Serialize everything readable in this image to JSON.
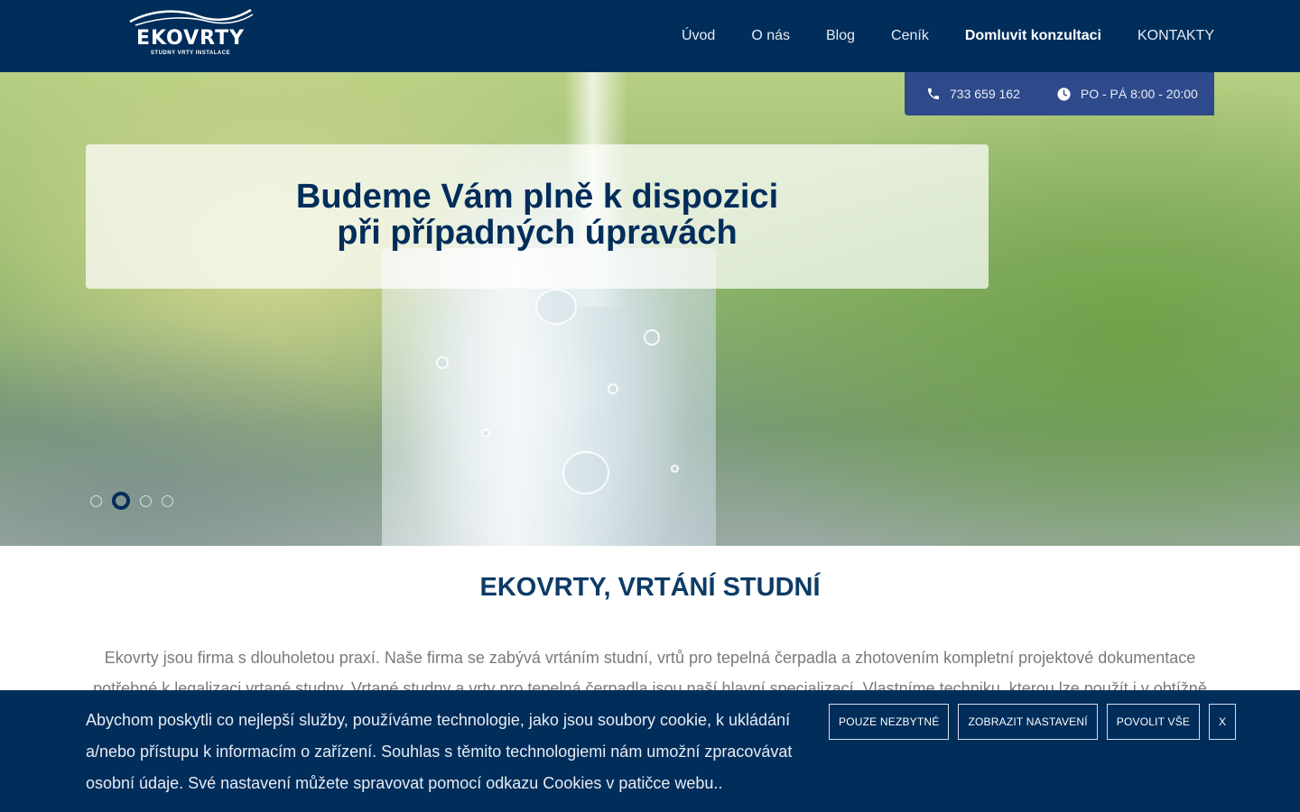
{
  "header": {
    "logo_text": "EKOVRTY",
    "logo_tagline": "STUDNY VRTY INSTALACE",
    "nav": [
      "Úvod",
      "O nás",
      "Blog",
      "Ceník",
      "Domluvit konzultaci",
      "KONTAKTY"
    ]
  },
  "contact": {
    "phone": "733 659 162",
    "hours": "PO - PÁ 8:00 - 20:00"
  },
  "hero": {
    "line1": "Budeme Vám plně k dispozici",
    "line2": "při případných úpravách",
    "slides_count": 4,
    "active_slide": 2
  },
  "main": {
    "title": "EKOVRTY, VRTÁNÍ STUDNÍ",
    "intro": "Ekovrty jsou firma s dlouholetou praxí. Naše firma se zabývá vrtáním studní, vrtů pro tepelná čerpadla a zhotovením kompletní projektové dokumentace potřebné k legalizaci vrtané studny. Vrtané studny a vrty pro tepelná čerpadla jsou naší hlavní specializací. Vlastníme techniku, kterou lze použít i v obtížně přístupných"
  },
  "cookie": {
    "text": "Abychom poskytli co nejlepší služby, používáme technologie, jako jsou soubory cookie, k ukládání a/nebo přístupu k informacím o zařízení. Souhlas s těmito technologiemi nám umožní zpracovávat osobní údaje. Své nastavení můžete spravovat pomocí odkazu Cookies v patičce webu..",
    "btn_necessary": "POUZE NEZBYTNÉ",
    "btn_settings": "ZOBRAZIT NASTAVENÍ",
    "btn_allow": "POVOLIT VŠE",
    "btn_close": "X"
  },
  "colors": {
    "navy": "#012d5b",
    "contact_bar": "#2f4a8a"
  }
}
